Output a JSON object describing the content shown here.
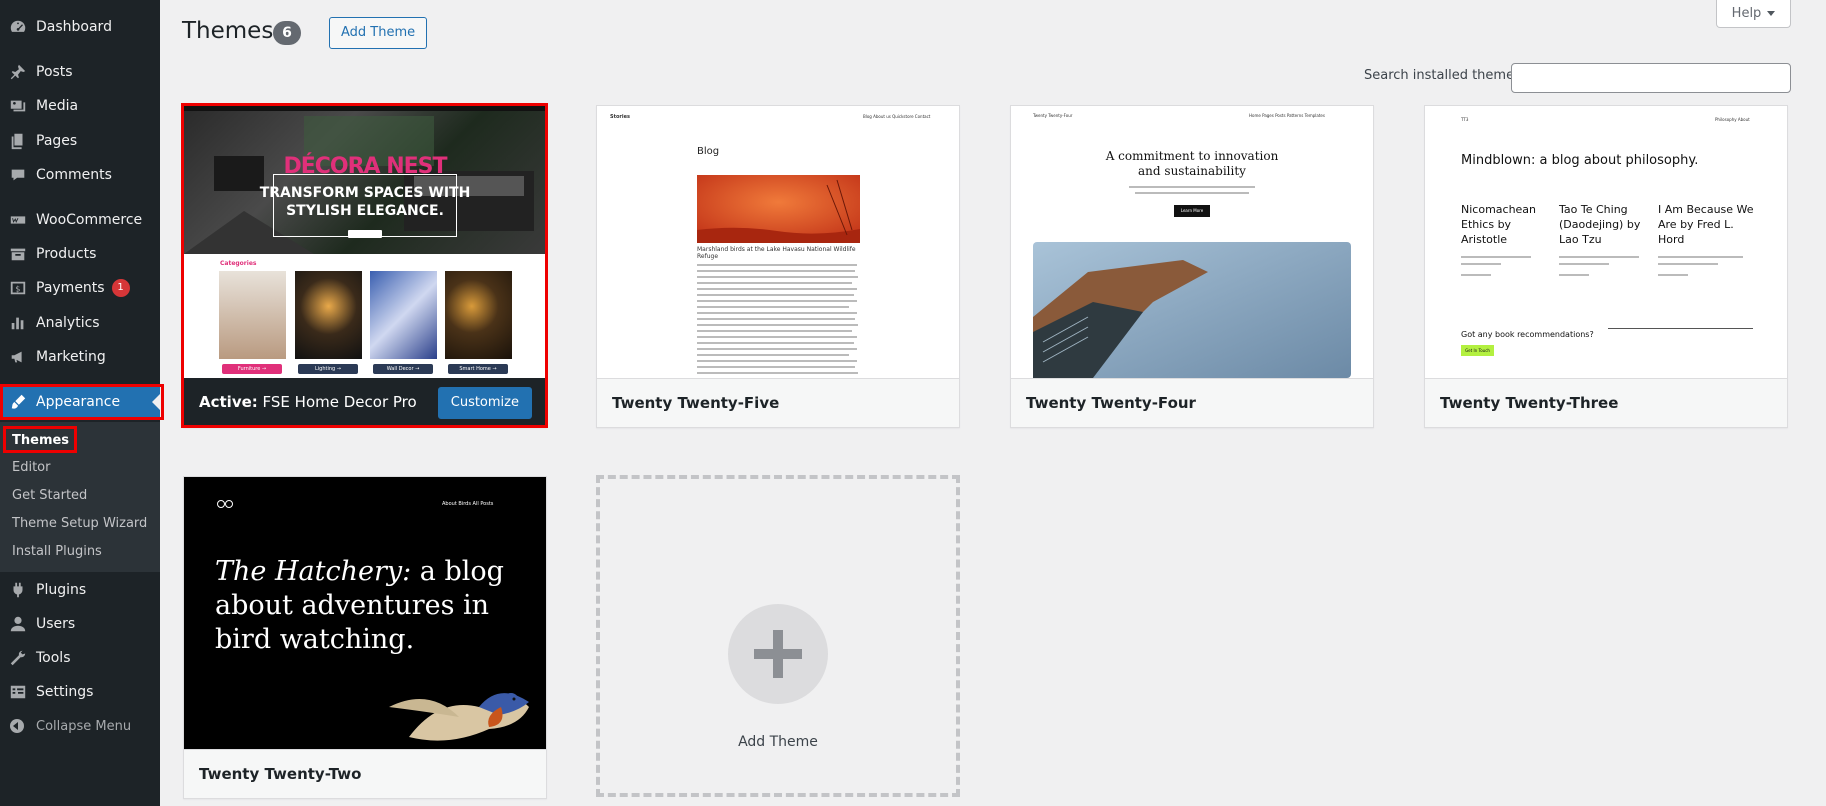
{
  "sidebar": {
    "items": [
      {
        "label": "Dashboard",
        "icon": "dashboard-icon"
      },
      {
        "label": "Posts",
        "icon": "pin-icon"
      },
      {
        "label": "Media",
        "icon": "media-icon"
      },
      {
        "label": "Pages",
        "icon": "pages-icon"
      },
      {
        "label": "Comments",
        "icon": "comments-icon"
      },
      {
        "label": "WooCommerce",
        "icon": "woocommerce-icon"
      },
      {
        "label": "Products",
        "icon": "products-icon"
      },
      {
        "label": "Payments",
        "icon": "payments-icon",
        "badge": "1"
      },
      {
        "label": "Analytics",
        "icon": "analytics-icon"
      },
      {
        "label": "Marketing",
        "icon": "megaphone-icon"
      },
      {
        "label": "Appearance",
        "icon": "brush-icon"
      },
      {
        "label": "Plugins",
        "icon": "plugins-icon"
      },
      {
        "label": "Users",
        "icon": "users-icon"
      },
      {
        "label": "Tools",
        "icon": "tools-icon"
      },
      {
        "label": "Settings",
        "icon": "settings-icon"
      }
    ],
    "submenu": [
      "Themes",
      "Editor",
      "Get Started",
      "Theme Setup Wizard",
      "Install Plugins"
    ],
    "collapse_label": "Collapse Menu"
  },
  "header": {
    "title": "Themes",
    "count": "6",
    "add_button": "Add Theme",
    "help": "Help"
  },
  "search": {
    "label": "Search installed themes",
    "value": ""
  },
  "themes": {
    "active": {
      "prefix": "Active:",
      "name": "FSE Home Decor Pro",
      "customize": "Customize",
      "preview": {
        "brand": "DÉCORA NEST",
        "headline_1": "TRANSFORM SPACES WITH",
        "headline_2": "STYLISH ELEGANCE.",
        "categories_heading": "Categories",
        "cats": [
          "Furniture →",
          "Lighting →",
          "Wall Decor →",
          "Smart Home →"
        ]
      }
    },
    "t25": {
      "name": "Twenty Twenty-Five",
      "preview": {
        "site": "Stories",
        "nav": "Blog   About us   Quickstore   Contact",
        "heading": "Blog",
        "caption": "Marshland birds at the Lake Havasu National Wildlife Refuge"
      }
    },
    "t24": {
      "name": "Twenty Twenty-Four",
      "preview": {
        "site": "Twenty Twenty-Four",
        "nav": "Home   Pages   Posts   Patterns   Templates",
        "heading_1": "A commitment to innovation",
        "heading_2": "and sustainability",
        "button": "Learn More"
      }
    },
    "t23": {
      "name": "Twenty Twenty-Three",
      "preview": {
        "site": "TT3",
        "nav": "Philosophy   About",
        "heading": "Mindblown: a blog about philosophy.",
        "post_1": "Nicomachean Ethics by Aristotle",
        "post_2": "Tao Te Ching (Daodejing) by Lao Tzu",
        "post_3": "I Am Because We Are by Fred L. Hord",
        "question": "Got any book recommendations?",
        "button": "Get In Touch"
      }
    },
    "t22": {
      "name": "Twenty Twenty-Two",
      "preview": {
        "nav": "About   Birds   All Posts",
        "heading_italic": "The Hatchery:",
        "heading_rest": "a blog about adventures in bird watching."
      }
    },
    "add_card_label": "Add Theme"
  },
  "colors": {
    "sidebar_bg": "#1d2327",
    "accent": "#2271b1",
    "highlight_outline": "#ee0000",
    "brand_pink": "#e0307a"
  }
}
